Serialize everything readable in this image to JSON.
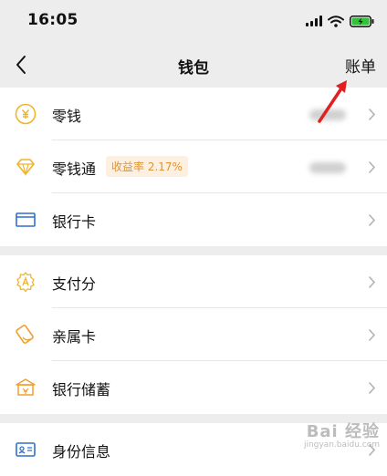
{
  "status_bar": {
    "time": "16:05"
  },
  "nav": {
    "title": "钱包",
    "action": "账单"
  },
  "wallet": {
    "items": [
      {
        "label": "零钱",
        "icon": "coin-icon"
      },
      {
        "label": "零钱通",
        "badge": "收益率 2.17%",
        "icon": "diamond-icon"
      },
      {
        "label": "银行卡",
        "icon": "bank-card-icon"
      }
    ]
  },
  "services": {
    "items": [
      {
        "label": "支付分",
        "icon": "payment-score-icon"
      },
      {
        "label": "亲属卡",
        "icon": "family-card-icon"
      },
      {
        "label": "银行储蓄",
        "icon": "bank-savings-icon"
      }
    ]
  },
  "identity": {
    "items": [
      {
        "label": "身份信息",
        "icon": "id-card-icon"
      }
    ]
  },
  "watermark": {
    "top": "Bai 经验",
    "bottom": "jingyan.baidu.com"
  },
  "colors": {
    "accent_blue": "#2f6fd0",
    "accent_gold": "#f0b429",
    "badge_text": "#e0942e",
    "annotation_red": "#e02020"
  }
}
